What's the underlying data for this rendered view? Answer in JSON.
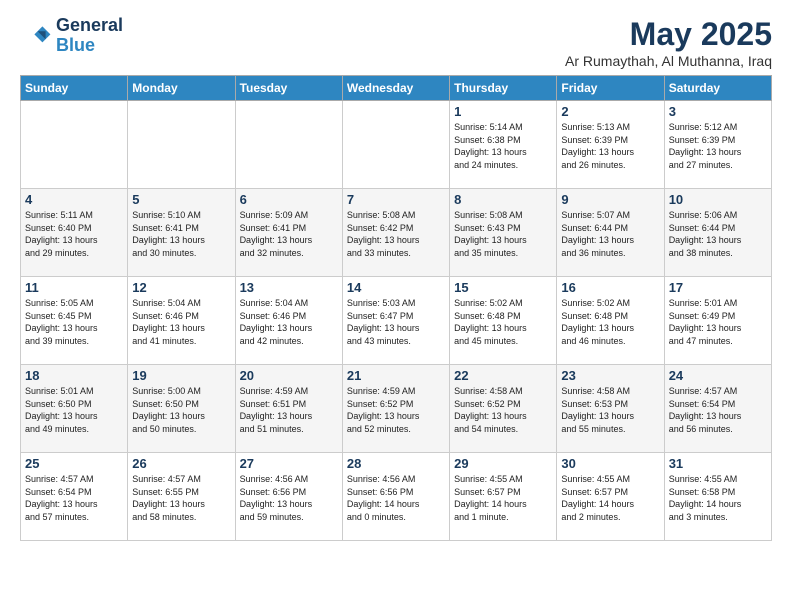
{
  "logo": {
    "line1": "General",
    "line2": "Blue"
  },
  "title": "May 2025",
  "subtitle": "Ar Rumaythah, Al Muthanna, Iraq",
  "headers": [
    "Sunday",
    "Monday",
    "Tuesday",
    "Wednesday",
    "Thursday",
    "Friday",
    "Saturday"
  ],
  "weeks": [
    [
      {
        "day": "",
        "info": ""
      },
      {
        "day": "",
        "info": ""
      },
      {
        "day": "",
        "info": ""
      },
      {
        "day": "",
        "info": ""
      },
      {
        "day": "1",
        "info": "Sunrise: 5:14 AM\nSunset: 6:38 PM\nDaylight: 13 hours\nand 24 minutes."
      },
      {
        "day": "2",
        "info": "Sunrise: 5:13 AM\nSunset: 6:39 PM\nDaylight: 13 hours\nand 26 minutes."
      },
      {
        "day": "3",
        "info": "Sunrise: 5:12 AM\nSunset: 6:39 PM\nDaylight: 13 hours\nand 27 minutes."
      }
    ],
    [
      {
        "day": "4",
        "info": "Sunrise: 5:11 AM\nSunset: 6:40 PM\nDaylight: 13 hours\nand 29 minutes."
      },
      {
        "day": "5",
        "info": "Sunrise: 5:10 AM\nSunset: 6:41 PM\nDaylight: 13 hours\nand 30 minutes."
      },
      {
        "day": "6",
        "info": "Sunrise: 5:09 AM\nSunset: 6:41 PM\nDaylight: 13 hours\nand 32 minutes."
      },
      {
        "day": "7",
        "info": "Sunrise: 5:08 AM\nSunset: 6:42 PM\nDaylight: 13 hours\nand 33 minutes."
      },
      {
        "day": "8",
        "info": "Sunrise: 5:08 AM\nSunset: 6:43 PM\nDaylight: 13 hours\nand 35 minutes."
      },
      {
        "day": "9",
        "info": "Sunrise: 5:07 AM\nSunset: 6:44 PM\nDaylight: 13 hours\nand 36 minutes."
      },
      {
        "day": "10",
        "info": "Sunrise: 5:06 AM\nSunset: 6:44 PM\nDaylight: 13 hours\nand 38 minutes."
      }
    ],
    [
      {
        "day": "11",
        "info": "Sunrise: 5:05 AM\nSunset: 6:45 PM\nDaylight: 13 hours\nand 39 minutes."
      },
      {
        "day": "12",
        "info": "Sunrise: 5:04 AM\nSunset: 6:46 PM\nDaylight: 13 hours\nand 41 minutes."
      },
      {
        "day": "13",
        "info": "Sunrise: 5:04 AM\nSunset: 6:46 PM\nDaylight: 13 hours\nand 42 minutes."
      },
      {
        "day": "14",
        "info": "Sunrise: 5:03 AM\nSunset: 6:47 PM\nDaylight: 13 hours\nand 43 minutes."
      },
      {
        "day": "15",
        "info": "Sunrise: 5:02 AM\nSunset: 6:48 PM\nDaylight: 13 hours\nand 45 minutes."
      },
      {
        "day": "16",
        "info": "Sunrise: 5:02 AM\nSunset: 6:48 PM\nDaylight: 13 hours\nand 46 minutes."
      },
      {
        "day": "17",
        "info": "Sunrise: 5:01 AM\nSunset: 6:49 PM\nDaylight: 13 hours\nand 47 minutes."
      }
    ],
    [
      {
        "day": "18",
        "info": "Sunrise: 5:01 AM\nSunset: 6:50 PM\nDaylight: 13 hours\nand 49 minutes."
      },
      {
        "day": "19",
        "info": "Sunrise: 5:00 AM\nSunset: 6:50 PM\nDaylight: 13 hours\nand 50 minutes."
      },
      {
        "day": "20",
        "info": "Sunrise: 4:59 AM\nSunset: 6:51 PM\nDaylight: 13 hours\nand 51 minutes."
      },
      {
        "day": "21",
        "info": "Sunrise: 4:59 AM\nSunset: 6:52 PM\nDaylight: 13 hours\nand 52 minutes."
      },
      {
        "day": "22",
        "info": "Sunrise: 4:58 AM\nSunset: 6:52 PM\nDaylight: 13 hours\nand 54 minutes."
      },
      {
        "day": "23",
        "info": "Sunrise: 4:58 AM\nSunset: 6:53 PM\nDaylight: 13 hours\nand 55 minutes."
      },
      {
        "day": "24",
        "info": "Sunrise: 4:57 AM\nSunset: 6:54 PM\nDaylight: 13 hours\nand 56 minutes."
      }
    ],
    [
      {
        "day": "25",
        "info": "Sunrise: 4:57 AM\nSunset: 6:54 PM\nDaylight: 13 hours\nand 57 minutes."
      },
      {
        "day": "26",
        "info": "Sunrise: 4:57 AM\nSunset: 6:55 PM\nDaylight: 13 hours\nand 58 minutes."
      },
      {
        "day": "27",
        "info": "Sunrise: 4:56 AM\nSunset: 6:56 PM\nDaylight: 13 hours\nand 59 minutes."
      },
      {
        "day": "28",
        "info": "Sunrise: 4:56 AM\nSunset: 6:56 PM\nDaylight: 14 hours\nand 0 minutes."
      },
      {
        "day": "29",
        "info": "Sunrise: 4:55 AM\nSunset: 6:57 PM\nDaylight: 14 hours\nand 1 minute."
      },
      {
        "day": "30",
        "info": "Sunrise: 4:55 AM\nSunset: 6:57 PM\nDaylight: 14 hours\nand 2 minutes."
      },
      {
        "day": "31",
        "info": "Sunrise: 4:55 AM\nSunset: 6:58 PM\nDaylight: 14 hours\nand 3 minutes."
      }
    ]
  ]
}
